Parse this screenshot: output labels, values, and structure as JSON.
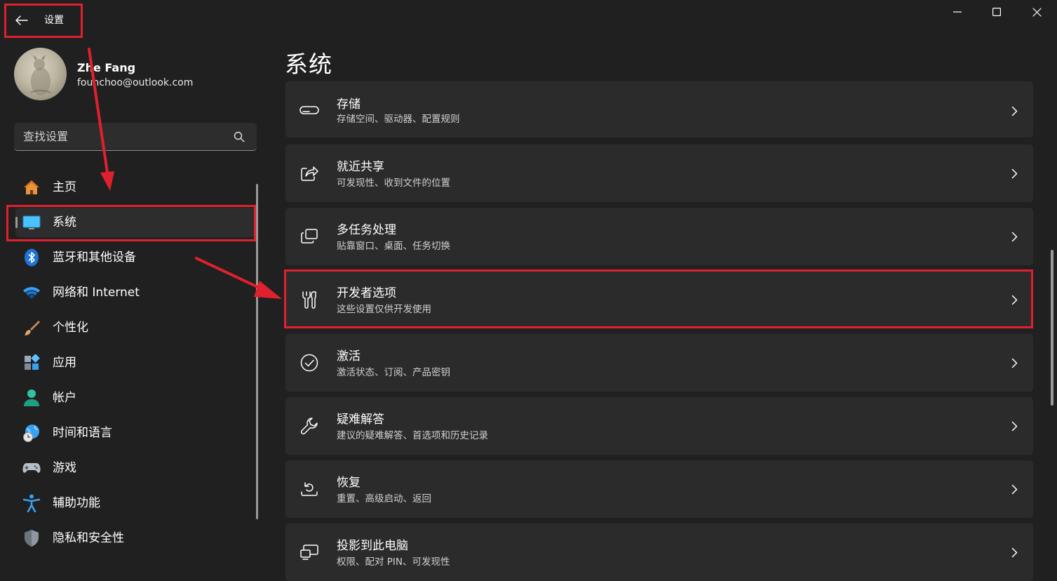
{
  "window": {
    "title": "设置"
  },
  "profile": {
    "name": "Zhe Fang",
    "email": "founchoo@outlook.com"
  },
  "search": {
    "placeholder": "查找设置"
  },
  "sidebar": {
    "items": [
      {
        "label": "主页",
        "icon": "home-icon"
      },
      {
        "label": "系统",
        "icon": "system-icon",
        "selected": true
      },
      {
        "label": "蓝牙和其他设备",
        "icon": "bluetooth-icon"
      },
      {
        "label": "网络和 Internet",
        "icon": "wifi-icon"
      },
      {
        "label": "个性化",
        "icon": "brush-icon"
      },
      {
        "label": "应用",
        "icon": "apps-icon"
      },
      {
        "label": "帐户",
        "icon": "account-icon"
      },
      {
        "label": "时间和语言",
        "icon": "globe-clock-icon"
      },
      {
        "label": "游戏",
        "icon": "gamepad-icon"
      },
      {
        "label": "辅助功能",
        "icon": "accessibility-icon"
      },
      {
        "label": "隐私和安全性",
        "icon": "shield-icon"
      }
    ]
  },
  "main": {
    "title": "系统",
    "cards": [
      {
        "title": "存储",
        "subtitle": "存储空间、驱动器、配置规则",
        "icon": "storage-icon"
      },
      {
        "title": "就近共享",
        "subtitle": "可发现性、收到文件的位置",
        "icon": "share-icon"
      },
      {
        "title": "多任务处理",
        "subtitle": "贴靠窗口、桌面、任务切换",
        "icon": "multitask-icon"
      },
      {
        "title": "开发者选项",
        "subtitle": "这些设置仅供开发使用",
        "icon": "developer-tools-icon",
        "highlighted": true
      },
      {
        "title": "激活",
        "subtitle": "激活状态、订阅、产品密钥",
        "icon": "checkmark-circle-icon"
      },
      {
        "title": "疑难解答",
        "subtitle": "建议的疑难解答、首选项和历史记录",
        "icon": "wrench-icon"
      },
      {
        "title": "恢复",
        "subtitle": "重置、高级启动、返回",
        "icon": "recovery-icon"
      },
      {
        "title": "投影到此电脑",
        "subtitle": "权限、配对 PIN、可发现性",
        "icon": "project-icon"
      }
    ]
  },
  "colors": {
    "background": "#202020",
    "card": "#2b2b2b",
    "annotation": "#e0202e"
  }
}
